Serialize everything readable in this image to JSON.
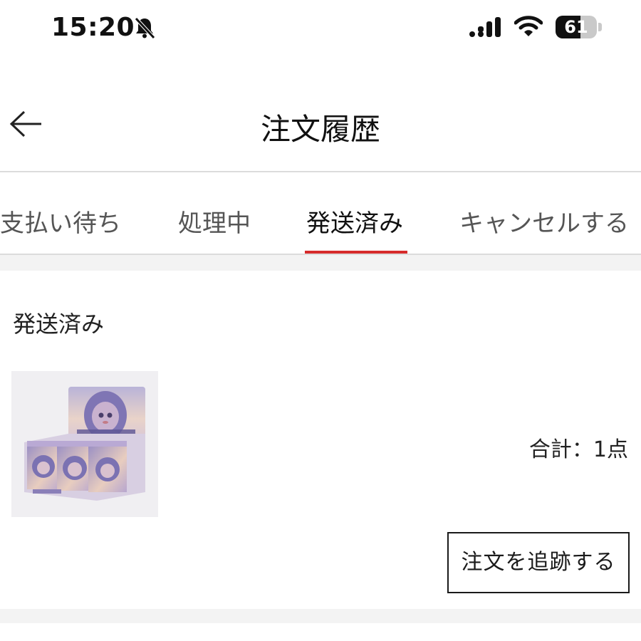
{
  "status_bar": {
    "time": "15:20",
    "battery_level": "61",
    "battery_fraction": 0.61,
    "icons": [
      "bell-slash-icon",
      "cellular-signal-icon",
      "wifi-icon",
      "battery-icon"
    ]
  },
  "header": {
    "title": "注文履歴",
    "back_icon": "arrow-left-icon"
  },
  "tabs": [
    {
      "label": "支払い待ち",
      "active": false
    },
    {
      "label": "処理中",
      "active": false
    },
    {
      "label": "発送済み",
      "active": true
    },
    {
      "label": "キャンセルする",
      "active": false
    }
  ],
  "order": {
    "status": "発送済み",
    "total": "合計：1点",
    "track_button": "注文を追跡する"
  },
  "colors": {
    "accent": "#d62b2b",
    "background": "#ffffff",
    "separator": "#f3f3f3"
  }
}
